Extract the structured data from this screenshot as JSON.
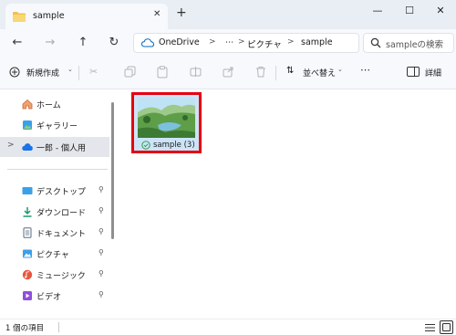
{
  "window": {
    "tab_title": "sample",
    "tab_close_glyph": "✕",
    "new_tab_glyph": "+",
    "minimize_glyph": "—",
    "maximize_glyph": "☐",
    "close_glyph": "✕"
  },
  "address": {
    "crumbs": [
      "OneDrive",
      "⋯",
      "ピクチャ",
      "sample"
    ],
    "separator": ">",
    "search_placeholder": "sampleの検索"
  },
  "commandbar": {
    "new_label": "新規作成",
    "sort_label": "並べ替え",
    "more_label": "⋯",
    "details_label": "詳細"
  },
  "sidebar": {
    "items": [
      {
        "label": "ホーム",
        "icon": "home-icon"
      },
      {
        "label": "ギャラリー",
        "icon": "gallery-icon"
      },
      {
        "label": "一郎 - 個人用",
        "icon": "onedrive-cloud-icon"
      },
      {
        "label": "デスクトップ",
        "icon": "desktop-icon",
        "pinned": true
      },
      {
        "label": "ダウンロード",
        "icon": "download-icon",
        "pinned": true
      },
      {
        "label": "ドキュメント",
        "icon": "documents-icon",
        "pinned": true
      },
      {
        "label": "ピクチャ",
        "icon": "pictures-icon",
        "pinned": true
      },
      {
        "label": "ミュージック",
        "icon": "music-icon",
        "pinned": true
      },
      {
        "label": "ビデオ",
        "icon": "video-icon",
        "pinned": true
      }
    ],
    "pin_glyph": "📌"
  },
  "content": {
    "items": [
      {
        "name": "sample (3)",
        "sync_status": "available-offline",
        "highlight_color": "#e50012"
      }
    ]
  },
  "status": {
    "item_count": "1 個の項目"
  },
  "colors": {
    "accent": "#0067c0",
    "selection": "#cce4f7",
    "highlight": "#e50012"
  }
}
